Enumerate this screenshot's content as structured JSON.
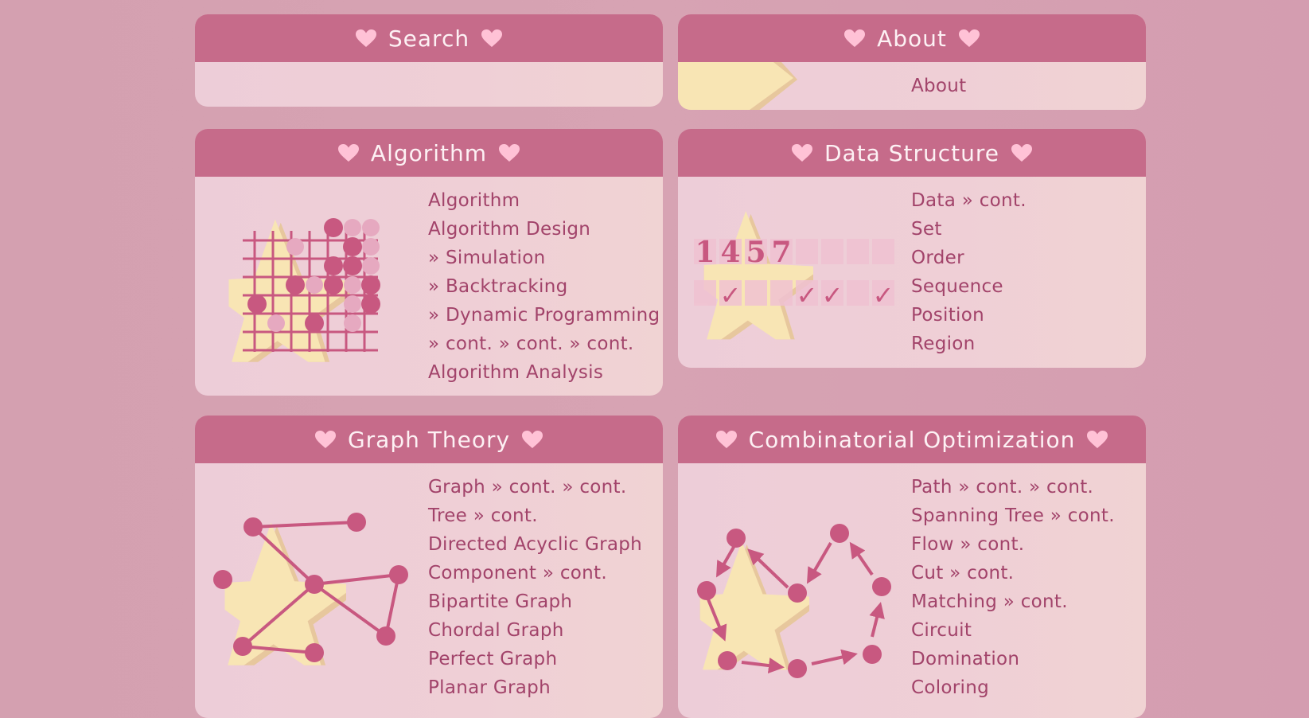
{
  "colors": {
    "background": "#d6a1b2",
    "header": "#c66b8a",
    "header_text": "#fdf1f4",
    "panel_body": "#eecfd8",
    "link_text": "#a2436a",
    "heart": "#ffc2d6",
    "star": "#f8e5b4",
    "accent": "#c85880"
  },
  "search": {
    "title": "Search"
  },
  "about": {
    "title": "About",
    "links": [
      "About"
    ]
  },
  "algorithm": {
    "title": "Algorithm",
    "links": [
      "Algorithm",
      "Algorithm Design",
      "» Simulation",
      "» Backtracking",
      "» Dynamic Programming",
      "» cont. » cont. » cont.",
      "Algorithm Analysis"
    ]
  },
  "data_structure": {
    "title": "Data Structure",
    "links": [
      "Data » cont.",
      "Set",
      "Order",
      "Sequence",
      "Position",
      "Region"
    ],
    "art_digits": [
      "1",
      "4",
      "5",
      "7"
    ],
    "art_check": "✓"
  },
  "graph_theory": {
    "title": "Graph Theory",
    "links": [
      "Graph » cont. » cont.",
      "Tree » cont.",
      "Directed Acyclic Graph",
      "Component » cont.",
      "Bipartite Graph",
      "Chordal Graph",
      "Perfect Graph",
      "Planar Graph"
    ]
  },
  "combinatorial_optimization": {
    "title": "Combinatorial Optimization",
    "links": [
      "Path » cont. » cont.",
      "Spanning Tree » cont.",
      "Flow » cont.",
      "Cut » cont.",
      "Matching » cont.",
      "Circuit",
      "Domination",
      "Coloring"
    ]
  }
}
